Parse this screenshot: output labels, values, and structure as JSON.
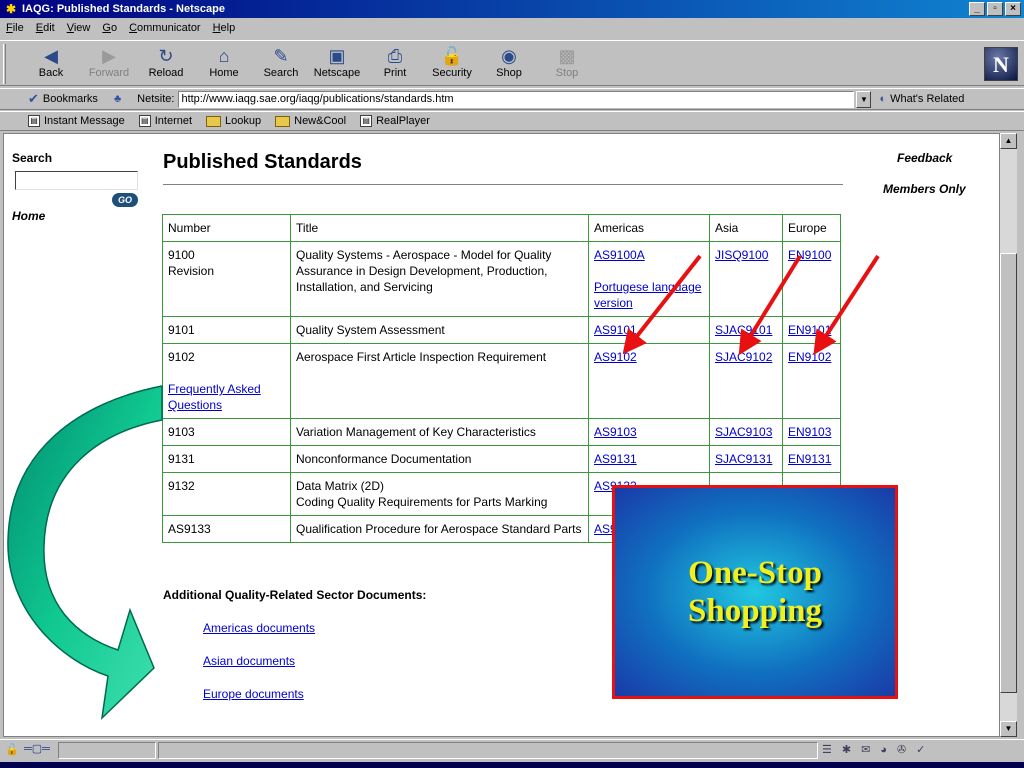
{
  "window": {
    "title": "IAQG: Published Standards - Netscape"
  },
  "menu": [
    "File",
    "Edit",
    "View",
    "Go",
    "Communicator",
    "Help"
  ],
  "toolbar": [
    {
      "label": "Back",
      "icon": "back-arrow-icon",
      "enabled": true
    },
    {
      "label": "Forward",
      "icon": "forward-arrow-icon",
      "enabled": false
    },
    {
      "label": "Reload",
      "icon": "reload-icon",
      "enabled": true
    },
    {
      "label": "Home",
      "icon": "home-icon",
      "enabled": true
    },
    {
      "label": "Search",
      "icon": "search-icon",
      "enabled": true
    },
    {
      "label": "Netscape",
      "icon": "netscape-icon",
      "enabled": true
    },
    {
      "label": "Print",
      "icon": "print-icon",
      "enabled": true
    },
    {
      "label": "Security",
      "icon": "lock-icon",
      "enabled": true
    },
    {
      "label": "Shop",
      "icon": "shop-icon",
      "enabled": true
    },
    {
      "label": "Stop",
      "icon": "stop-icon",
      "enabled": false
    }
  ],
  "location": {
    "bookmarks_label": "Bookmarks",
    "netsite_label": "Netsite:",
    "url": "http://www.iaqg.sae.org/iaqg/publications/standards.htm",
    "related_label": "What's Related"
  },
  "personal_bar": [
    "Instant Message",
    "Internet",
    "Lookup",
    "New&Cool",
    "RealPlayer"
  ],
  "sidebar": {
    "search_label": "Search",
    "go_label": "GO",
    "home_label": "Home"
  },
  "right_links": {
    "feedback": "Feedback",
    "members": "Members Only"
  },
  "page": {
    "title": "Published Standards",
    "table": {
      "headers": [
        "Number",
        "Title",
        "Americas",
        "Asia",
        "Europe"
      ],
      "rows": [
        {
          "number": "9100",
          "number_sub": "Revision",
          "title": "Quality Systems - Aerospace - Model for Quality Assurance in Design Development, Production, Installation, and Servicing",
          "americas": "AS9100A",
          "americas_extra": "Portugese language version",
          "asia": "JISQ9100",
          "europe": "EN9100"
        },
        {
          "number": "9101",
          "title": "Quality System Assessment",
          "americas": "AS9101",
          "asia": "SJAC9101",
          "europe": "EN9101"
        },
        {
          "number": "9102",
          "number_link": "Frequently Asked Questions",
          "title": "Aerospace First Article Inspection Requirement",
          "americas": "AS9102",
          "asia": "SJAC9102",
          "europe": "EN9102"
        },
        {
          "number": "9103",
          "title": "Variation Management of Key Characteristics",
          "americas": "AS9103",
          "asia": "SJAC9103",
          "europe": "EN9103"
        },
        {
          "number": "9131",
          "title": "Nonconformance Documentation",
          "americas": "AS9131",
          "asia": "SJAC9131",
          "europe": "EN9131"
        },
        {
          "number": "9132",
          "title": "Data Matrix (2D)",
          "title_sub": "Coding Quality Requirements for Parts Marking",
          "americas": "AS9132",
          "asia": "",
          "europe": ""
        },
        {
          "number": "AS9133",
          "title": "Qualification Procedure for Aerospace Standard Parts",
          "americas": "AS9133",
          "asia": "",
          "europe": ""
        }
      ]
    },
    "additional_heading": "Additional Quality-Related Sector Documents:",
    "additional_links": [
      "Americas documents",
      "Asian documents",
      "Europe documents"
    ]
  },
  "callout": {
    "line1": "One-Stop",
    "line2": "Shopping"
  },
  "colors": {
    "callout_text": "#f0f020",
    "callout_border": "#e81010",
    "arrow_red": "#e81010",
    "swoosh_green": "#10c890",
    "link": "#0000cc",
    "table_border": "#3a9a3a"
  }
}
